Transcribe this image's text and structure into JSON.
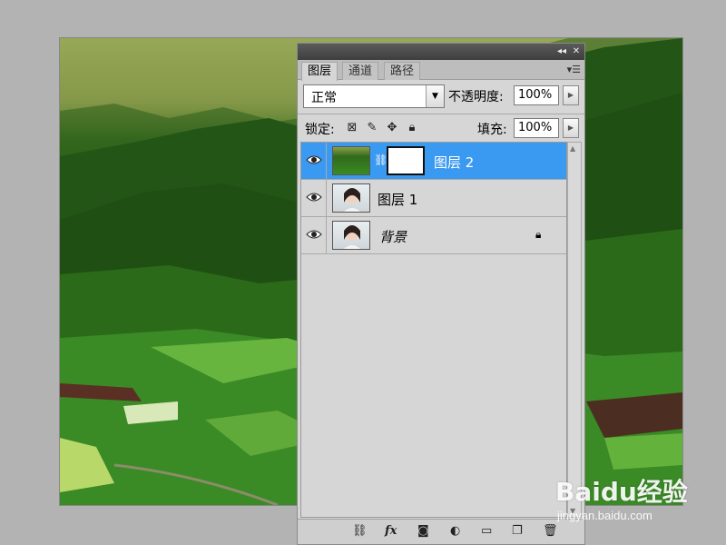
{
  "tabs": [
    {
      "label": "图层",
      "active": true
    },
    {
      "label": "通道",
      "active": false
    },
    {
      "label": "路径",
      "active": false
    }
  ],
  "blend_mode": {
    "value": "正常"
  },
  "opacity": {
    "label": "不透明度:",
    "value": "100%"
  },
  "lock": {
    "label": "锁定:",
    "icons": [
      "transparency-lock-icon",
      "brush-lock-icon",
      "move-lock-icon",
      "padlock-icon"
    ]
  },
  "fill": {
    "label": "填充:",
    "value": "100%"
  },
  "layers": [
    {
      "name": "图层 2",
      "selected": true,
      "thumb": "landscape",
      "mask": true
    },
    {
      "name": "图层 1",
      "selected": false,
      "thumb": "portrait"
    },
    {
      "name": "背景",
      "selected": false,
      "thumb": "portrait",
      "locked": true
    }
  ],
  "bottom_tools": [
    "link-icon",
    "fx-icon",
    "mask-icon",
    "adjustment-icon",
    "folder-icon",
    "new-layer-icon",
    "trash-icon"
  ],
  "bottom_fx_text": "fx",
  "watermark": {
    "brand": "Baidu经验",
    "url": "jingyan.baidu.com"
  },
  "colors": {
    "selection": "#3a99f0",
    "panel_bg": "#d6d6d6",
    "workspace": "#b3b3b3"
  }
}
